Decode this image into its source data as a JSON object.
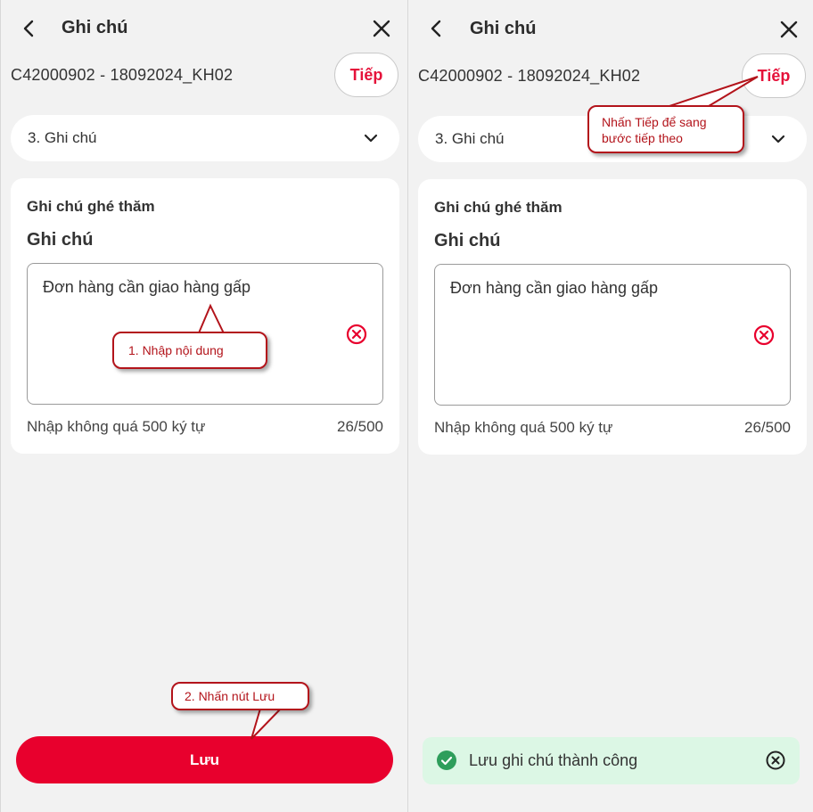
{
  "left": {
    "header": {
      "title": "Ghi chú"
    },
    "order_code": "C42000902 - 18092024_KH02",
    "next_label": "Tiếp",
    "step_select": "3. Ghi chú",
    "card": {
      "heading": "Ghi chú ghé thăm",
      "label": "Ghi chú",
      "note_value": "Đơn hàng cần giao hàng gấp",
      "hint": "Nhập không quá 500 ký tự",
      "counter": "26/500"
    },
    "save_label": "Lưu",
    "callouts": {
      "enter_content": "1. Nhập nội dung",
      "press_save": "2. Nhấn nút Lưu"
    }
  },
  "right": {
    "header": {
      "title": "Ghi chú"
    },
    "order_code": "C42000902 - 18092024_KH02",
    "next_label": "Tiếp",
    "step_select": "3. Ghi chú",
    "card": {
      "heading": "Ghi chú ghé thăm",
      "label": "Ghi chú",
      "note_value": "Đơn hàng cần giao hàng gấp",
      "hint": "Nhập không quá 500 ký tự",
      "counter": "26/500"
    },
    "toast": {
      "message": "Lưu ghi chú thành công"
    },
    "callouts": {
      "press_next_line1": "Nhấn Tiếp để sang",
      "press_next_line2": "bước tiếp theo"
    }
  },
  "colors": {
    "accent": "#e8002d",
    "callout": "#b3141b",
    "toast_bg": "#dcf7e5",
    "success": "#2e9e5b"
  }
}
